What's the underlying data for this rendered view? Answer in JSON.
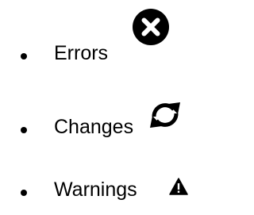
{
  "legend": {
    "items": [
      {
        "label": "Errors",
        "icon": "error-x-circle-icon",
        "icon_color": "#000000"
      },
      {
        "label": "Changes",
        "icon": "sync-arrows-icon",
        "icon_color": "#000000"
      },
      {
        "label": "Warnings",
        "icon": "warning-triangle-icon",
        "icon_color": "#000000"
      }
    ]
  }
}
